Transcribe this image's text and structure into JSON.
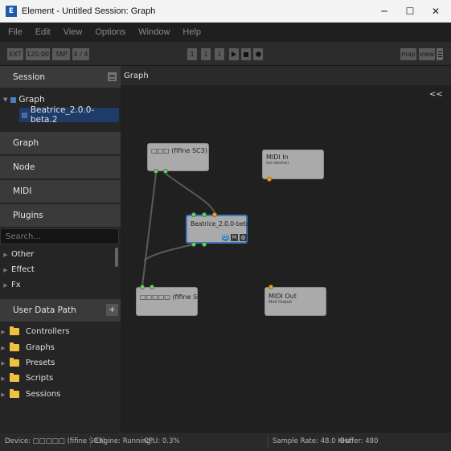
{
  "window": {
    "title": "Element - Untitled Session: Graph",
    "app_icon": "E"
  },
  "controls": {
    "minimize": "─",
    "maximize": "☐",
    "close": "✕"
  },
  "menu": [
    "File",
    "Edit",
    "View",
    "Options",
    "Window",
    "Help"
  ],
  "transport": {
    "ext": "EXT",
    "tempo": "120.00",
    "tap": "TAP",
    "meter": "4 / 4",
    "bar": "1",
    "beat": "1",
    "tick": "1",
    "play_icon": "play-icon",
    "stop_icon": "stop-icon",
    "record_icon": "record-icon",
    "map": "map",
    "view": "view"
  },
  "session": {
    "header": "Session",
    "graph_label": "Graph",
    "selected_node": "Beatrice_2.0.0-beta.2"
  },
  "sections": [
    "Graph",
    "Node",
    "MIDI",
    "Plugins"
  ],
  "plugins": {
    "search_placeholder": "Search...",
    "categories": [
      "Other",
      "Effect",
      "Fx"
    ]
  },
  "user_data": {
    "header": "User Data Path",
    "add": "+",
    "folders": [
      "Controllers",
      "Graphs",
      "Presets",
      "Scripts",
      "Sessions"
    ]
  },
  "graph_view": {
    "header": "Graph",
    "collapse": "<<",
    "nodes": {
      "input_device": "□□□ (fifine SC3)",
      "midi_in": "MIDI In",
      "midi_in_sub": "(no device)",
      "plugin": "Beatrice_2.0.0-beta.2",
      "plugin_mute": "M",
      "output_device": "□□□□□ (fifine SC3)",
      "midi_out": "MIDI Out",
      "midi_out_sub": "Midi Output"
    }
  },
  "status": {
    "device": "Device: □□□□□ (fifine SC3)",
    "engine": "Engine: Running:",
    "cpu": "CPU: 0.3%",
    "sample_rate": "Sample Rate: 48.0 KHz:",
    "buffer": "Buffer: 480"
  },
  "colors": {
    "accent": "#1e5aa8",
    "port_audio": "#6ad26a",
    "port_midi": "#f0a020",
    "selected_node": "#3a78c0",
    "folder": "#f0c040"
  }
}
